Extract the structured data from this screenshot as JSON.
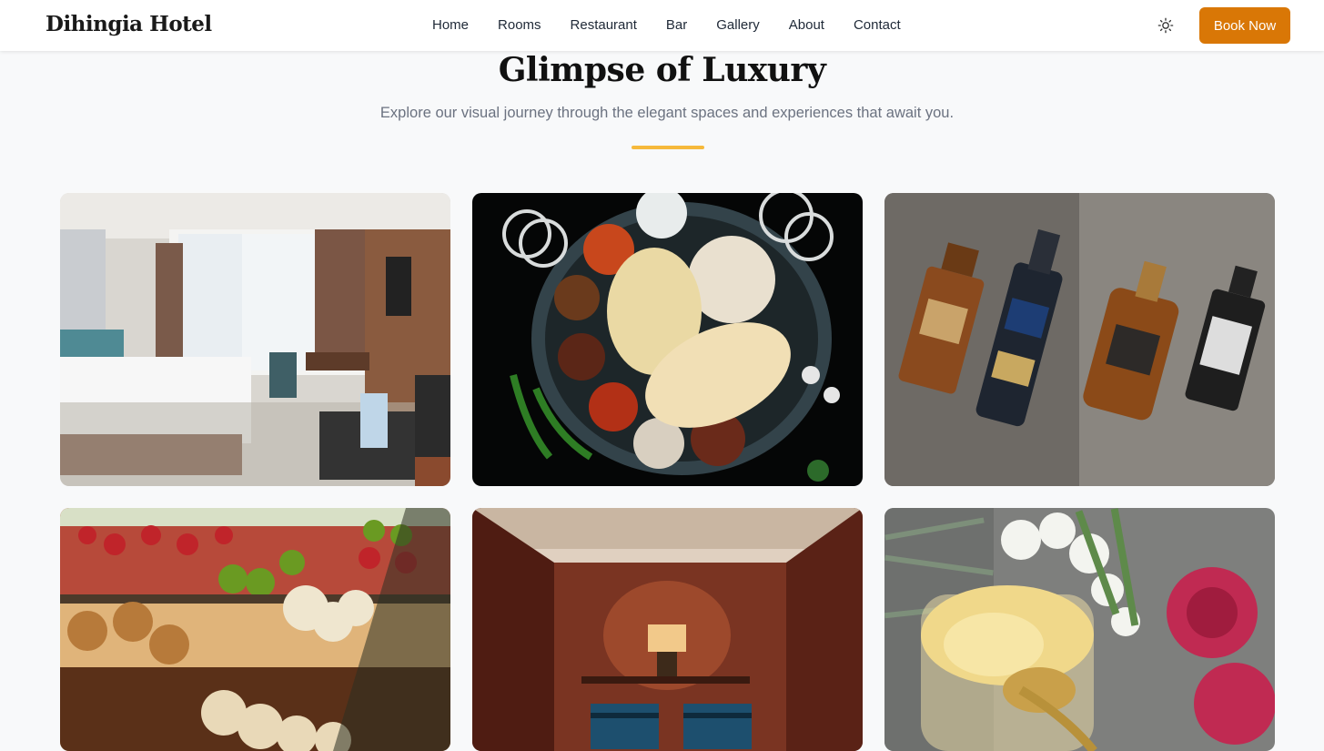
{
  "header": {
    "brand": "Dihingia Hotel",
    "nav": [
      "Home",
      "Rooms",
      "Restaurant",
      "Bar",
      "Gallery",
      "About",
      "Contact"
    ],
    "theme_icon": "sun-icon",
    "book_label": "Book Now",
    "accent_color": "#d97706"
  },
  "section": {
    "title": "Glimpse of Luxury",
    "subtitle": "Explore our visual journey through the elegant spaces and experiences that await you.",
    "divider_color": "#f6b93b"
  },
  "gallery": {
    "images": [
      {
        "subject": "hotel-room"
      },
      {
        "subject": "thali-platter"
      },
      {
        "subject": "liquor-bottles"
      },
      {
        "subject": "pastry-display"
      },
      {
        "subject": "spa-room"
      },
      {
        "subject": "ghee-jar-flowers"
      }
    ]
  }
}
